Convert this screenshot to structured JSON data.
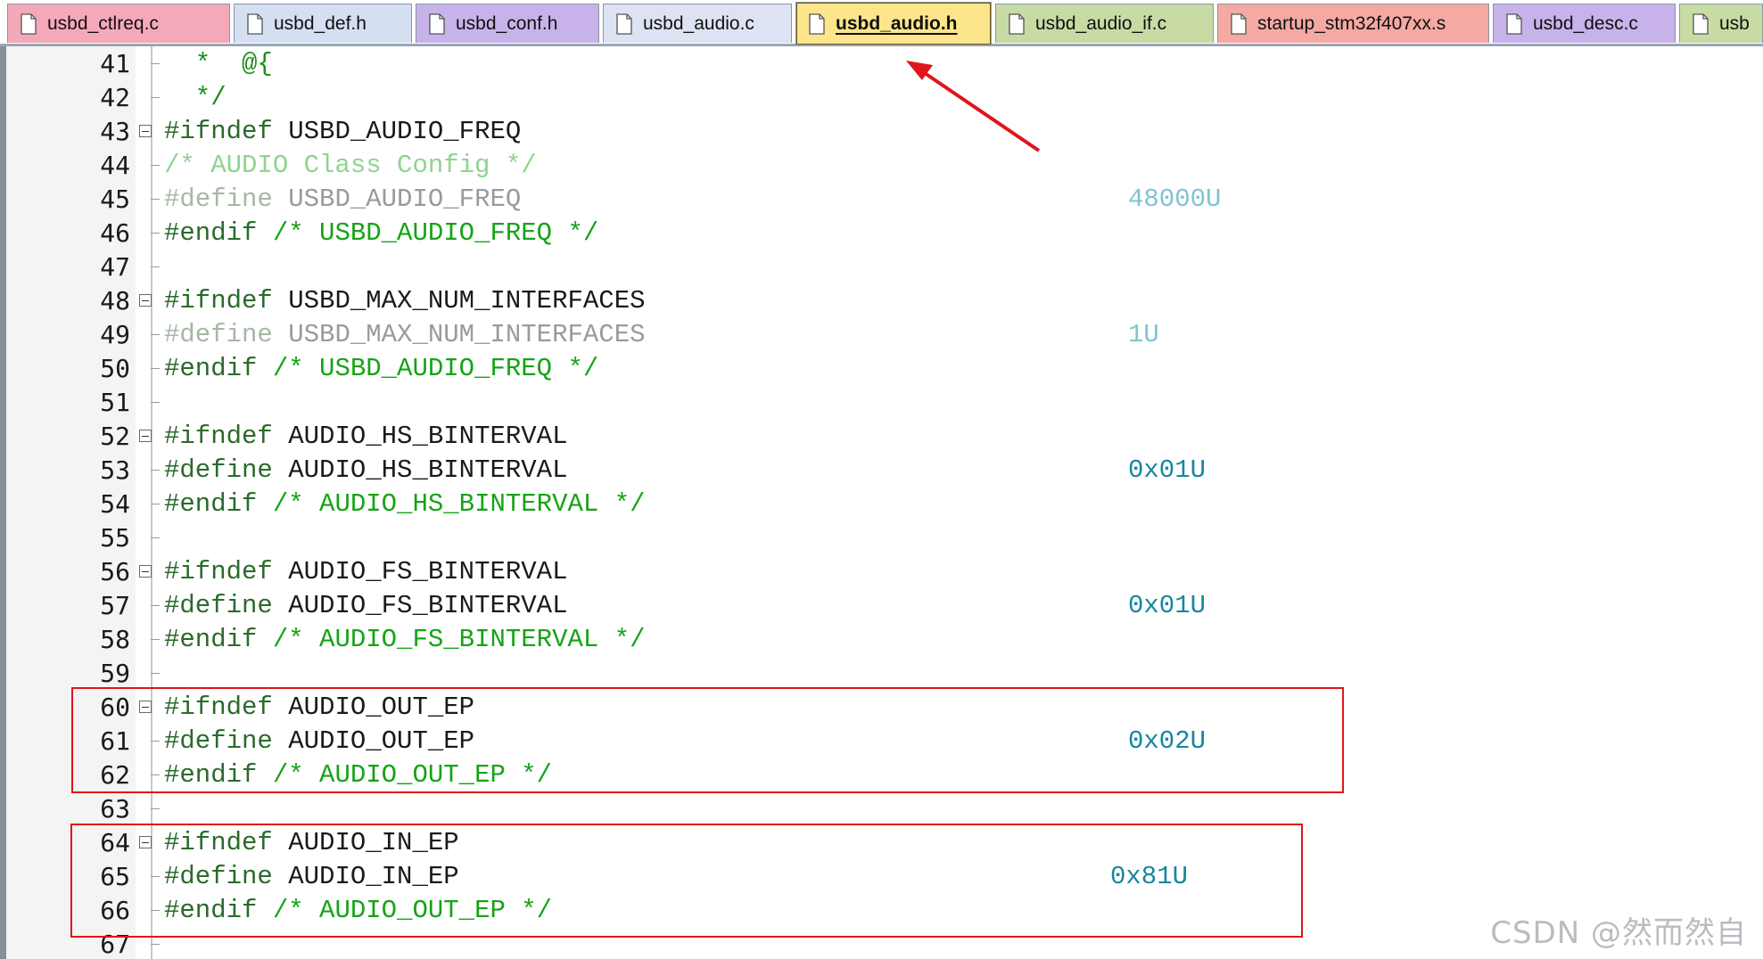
{
  "tabs": [
    {
      "label": "usbd_ctlreq.c",
      "bg": "#f4a9ba",
      "active": false
    },
    {
      "label": "usbd_def.h",
      "bg": "#d5dff2",
      "active": false
    },
    {
      "label": "usbd_conf.h",
      "bg": "#c7b3ea",
      "active": false
    },
    {
      "label": "usbd_audio.c",
      "bg": "#dde3f2",
      "active": false
    },
    {
      "label": "usbd_audio.h",
      "bg": "#fde58c",
      "active": true
    },
    {
      "label": "usbd_audio_if.c",
      "bg": "#c8dba5",
      "active": false
    },
    {
      "label": "startup_stm32f407xx.s",
      "bg": "#f4a9a3",
      "active": false
    },
    {
      "label": "usbd_desc.c",
      "bg": "#c7b3ea",
      "active": false
    },
    {
      "label": "usb",
      "bg": "#c8dba5",
      "active": false
    }
  ],
  "lines": [
    {
      "n": "41",
      "marker": "tick",
      "tokens": [
        {
          "t": "  *  @{",
          "c": "c-star"
        }
      ]
    },
    {
      "n": "42",
      "marker": "tick",
      "tokens": [
        {
          "t": "  */",
          "c": "c-star"
        }
      ]
    },
    {
      "n": "43",
      "marker": "box",
      "tokens": [
        {
          "t": "#ifndef ",
          "c": "c-directive"
        },
        {
          "t": "USBD_AUDIO_FREQ",
          "c": "c-ident"
        }
      ]
    },
    {
      "n": "44",
      "marker": "tick",
      "tokens": [
        {
          "t": "/* AUDIO Class Config */",
          "c": "c-comment-dim"
        }
      ]
    },
    {
      "n": "45",
      "marker": "tick",
      "tokens": [
        {
          "t": "#define ",
          "c": "c-directive-dim"
        },
        {
          "t": "USBD_AUDIO_FREQ",
          "c": "c-ident-dim"
        }
      ],
      "value": "48000U",
      "vcls": "c-num-dim",
      "vpos": "far"
    },
    {
      "n": "46",
      "marker": "tick",
      "tokens": [
        {
          "t": "#endif ",
          "c": "c-directive"
        },
        {
          "t": "/* USBD_AUDIO_FREQ */",
          "c": "c-comment"
        }
      ]
    },
    {
      "n": "47",
      "marker": "tick",
      "tokens": []
    },
    {
      "n": "48",
      "marker": "box",
      "tokens": [
        {
          "t": "#ifndef ",
          "c": "c-directive"
        },
        {
          "t": "USBD_MAX_NUM_INTERFACES",
          "c": "c-ident"
        }
      ]
    },
    {
      "n": "49",
      "marker": "tick",
      "tokens": [
        {
          "t": "#define ",
          "c": "c-directive-dim"
        },
        {
          "t": "USBD_MAX_NUM_INTERFACES",
          "c": "c-ident-dim"
        }
      ],
      "value": "1U",
      "vcls": "c-num-dim",
      "vpos": "far"
    },
    {
      "n": "50",
      "marker": "tick",
      "tokens": [
        {
          "t": "#endif ",
          "c": "c-directive"
        },
        {
          "t": "/* USBD_AUDIO_FREQ */",
          "c": "c-comment"
        }
      ]
    },
    {
      "n": "51",
      "marker": "tick",
      "tokens": []
    },
    {
      "n": "52",
      "marker": "box",
      "tokens": [
        {
          "t": "#ifndef ",
          "c": "c-directive"
        },
        {
          "t": "AUDIO_HS_BINTERVAL",
          "c": "c-ident"
        }
      ]
    },
    {
      "n": "53",
      "marker": "tick",
      "tokens": [
        {
          "t": "#define ",
          "c": "c-directive"
        },
        {
          "t": "AUDIO_HS_BINTERVAL",
          "c": "c-ident"
        }
      ],
      "value": "0x01U",
      "vcls": "c-num",
      "vpos": "far"
    },
    {
      "n": "54",
      "marker": "tick",
      "tokens": [
        {
          "t": "#endif ",
          "c": "c-directive"
        },
        {
          "t": "/* AUDIO_HS_BINTERVAL */",
          "c": "c-comment"
        }
      ]
    },
    {
      "n": "55",
      "marker": "tick",
      "tokens": []
    },
    {
      "n": "56",
      "marker": "box",
      "tokens": [
        {
          "t": "#ifndef ",
          "c": "c-directive"
        },
        {
          "t": "AUDIO_FS_BINTERVAL",
          "c": "c-ident"
        }
      ]
    },
    {
      "n": "57",
      "marker": "tick",
      "tokens": [
        {
          "t": "#define ",
          "c": "c-directive"
        },
        {
          "t": "AUDIO_FS_BINTERVAL",
          "c": "c-ident"
        }
      ],
      "value": "0x01U",
      "vcls": "c-num",
      "vpos": "far"
    },
    {
      "n": "58",
      "marker": "tick",
      "tokens": [
        {
          "t": "#endif ",
          "c": "c-directive"
        },
        {
          "t": "/* AUDIO_FS_BINTERVAL */",
          "c": "c-comment"
        }
      ]
    },
    {
      "n": "59",
      "marker": "tick",
      "tokens": []
    },
    {
      "n": "60",
      "marker": "box",
      "tokens": [
        {
          "t": "#ifndef ",
          "c": "c-directive"
        },
        {
          "t": "AUDIO_OUT_EP",
          "c": "c-ident"
        }
      ]
    },
    {
      "n": "61",
      "marker": "tick",
      "tokens": [
        {
          "t": "#define ",
          "c": "c-directive"
        },
        {
          "t": "AUDIO_OUT_EP",
          "c": "c-ident"
        }
      ],
      "value": "0x02U",
      "vcls": "c-num",
      "vpos": "far"
    },
    {
      "n": "62",
      "marker": "tick",
      "tokens": [
        {
          "t": "#endif ",
          "c": "c-directive"
        },
        {
          "t": "/* AUDIO_OUT_EP */",
          "c": "c-comment"
        }
      ]
    },
    {
      "n": "63",
      "marker": "tick",
      "tokens": []
    },
    {
      "n": "64",
      "marker": "box",
      "tokens": [
        {
          "t": "#ifndef ",
          "c": "c-directive"
        },
        {
          "t": "AUDIO_IN_EP",
          "c": "c-ident"
        }
      ]
    },
    {
      "n": "65",
      "marker": "tick",
      "tokens": [
        {
          "t": "#define ",
          "c": "c-directive"
        },
        {
          "t": "AUDIO_IN_EP",
          "c": "c-ident"
        }
      ],
      "value": "0x81U",
      "vcls": "c-num",
      "vpos": "near"
    },
    {
      "n": "66",
      "marker": "tick",
      "tokens": [
        {
          "t": "#endif ",
          "c": "c-directive"
        },
        {
          "t": "/* AUDIO_OUT_EP */",
          "c": "c-comment"
        }
      ]
    },
    {
      "n": "67",
      "marker": "tick",
      "tokens": []
    }
  ],
  "watermark": "CSDN @然而然自",
  "colors": {
    "highlight_box": "#e0141b",
    "arrow": "#e0141b",
    "active_tab": "#fde58c"
  }
}
